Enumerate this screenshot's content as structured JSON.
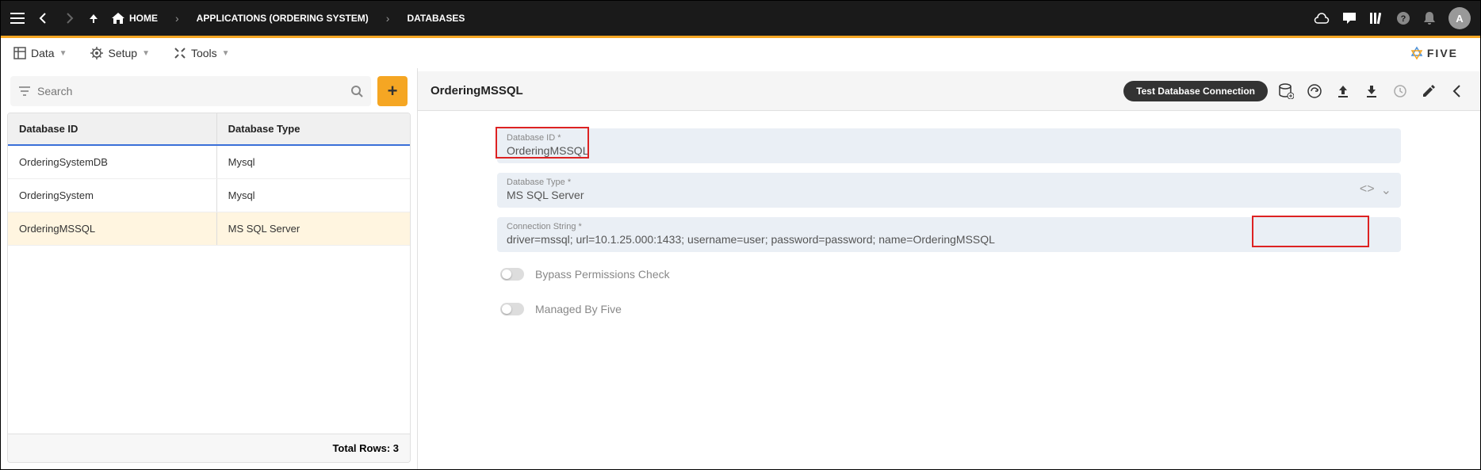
{
  "topbar": {
    "home": "HOME",
    "crumb_applications": "APPLICATIONS (ORDERING SYSTEM)",
    "crumb_databases": "DATABASES",
    "avatar_letter": "A"
  },
  "menubar": {
    "data": "Data",
    "setup": "Setup",
    "tools": "Tools",
    "brand": "FIVE"
  },
  "sidebar": {
    "search_placeholder": "Search",
    "columns": {
      "id": "Database ID",
      "type": "Database Type"
    },
    "rows": [
      {
        "id": "OrderingSystemDB",
        "type": "Mysql"
      },
      {
        "id": "OrderingSystem",
        "type": "Mysql"
      },
      {
        "id": "OrderingMSSQL",
        "type": "MS SQL Server"
      }
    ],
    "footer": "Total Rows: 3"
  },
  "detail": {
    "title": "OrderingMSSQL",
    "test_button": "Test Database Connection",
    "fields": {
      "db_id_label": "Database ID *",
      "db_id_value": "OrderingMSSQL",
      "db_type_label": "Database Type *",
      "db_type_value": "MS SQL Server",
      "conn_label": "Connection String *",
      "conn_value": "driver=mssql; url=10.1.25.000:1433; username=user; password=password; name=OrderingMSSQL"
    },
    "toggles": {
      "bypass": "Bypass Permissions Check",
      "managed": "Managed By Five"
    }
  }
}
